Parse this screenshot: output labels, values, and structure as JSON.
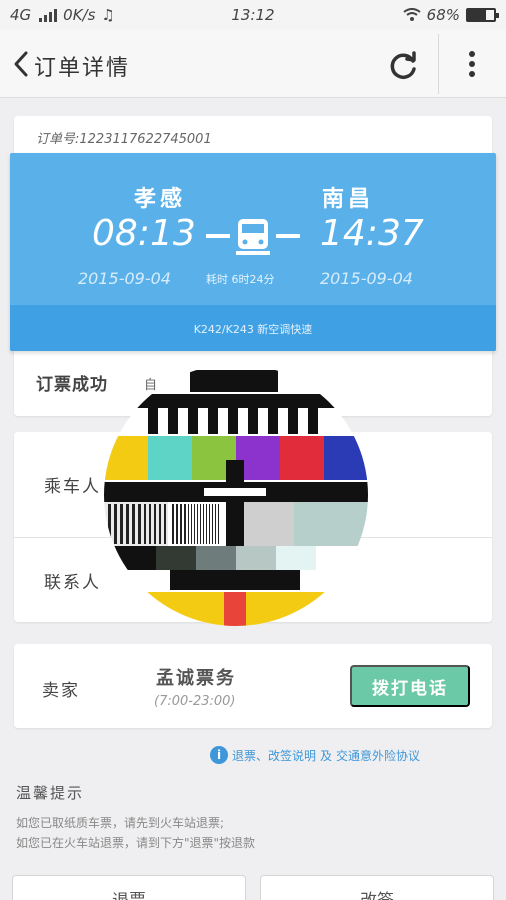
{
  "status_bar": {
    "network": "4G",
    "speed": "0K/s",
    "time": "13:12",
    "battery": "68%",
    "battery_level": 0.68
  },
  "nav": {
    "title": "订单详情",
    "back_icon": "chevron-left-icon",
    "refresh_icon": "refresh-icon",
    "more_icon": "more-vertical-icon"
  },
  "order": {
    "order_no": "订单号:1223117622745001",
    "departure_station": "孝感",
    "arrival_station": "南昌",
    "departure_time": "08:13",
    "arrival_time": "14:37",
    "departure_date": "2015-09-04",
    "arrival_date": "2015-09-04",
    "duration": "耗时 6时24分",
    "train_no": "K242/K243 新空调快速",
    "status": "订票成功",
    "status_extra": "自"
  },
  "people": {
    "passenger_label": "乘车人",
    "contact_label": "联系人"
  },
  "seller": {
    "label": "卖家",
    "name": "孟诚票务",
    "hours": "(7:00-23:00)",
    "call_button": "拨打电话"
  },
  "links": {
    "info_icon": "info-icon",
    "refund_note": "退票、改签说明",
    "and": "及",
    "insurance": "交通意外险协议"
  },
  "tips": {
    "title": "温馨提示",
    "line1": "如您已取纸质车票，请先到火车站退票;",
    "line2": "如您已在火车站退票，请到下方\"退票\"按退款"
  },
  "actions": {
    "refund": "退票",
    "change": "改签"
  },
  "colors": {
    "train_panel": "#5ab1ea",
    "panel_footer": "#3fa1e4",
    "call_button": "#6cc9a7",
    "link": "#3e97d9"
  }
}
